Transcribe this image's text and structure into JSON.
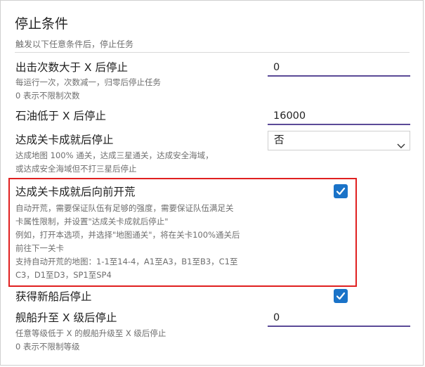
{
  "header": {
    "title": "停止条件",
    "subtitle": "触发以下任意条件后，停止任务"
  },
  "items": [
    {
      "label": "出击次数大于 X 后停止",
      "desc_lines": [
        "每运行一次，次数减一，归零后停止任务",
        "0 表示不限制次数"
      ],
      "input_value": "0"
    },
    {
      "label": "石油低于 X 后停止",
      "input_value": "16000"
    },
    {
      "label": "达成关卡成就后停止",
      "desc_lines": [
        "达成地图 100% 通关，达成三星通关，达成安全海域，",
        "或达成安全海域但不打三星后停止"
      ],
      "select_value": "否"
    },
    {
      "label": "达成关卡成就后向前开荒",
      "desc_lines": [
        "自动开荒，需要保证队伍有足够的强度，需要保证队伍满足关",
        "卡属性限制，并设置\"达成关卡成就后停止\"",
        "例如，打开本选项，并选择\"地图通关\"，将在关卡100%通关后",
        "前往下一关卡",
        "支持自动开荒的地图：1-1至14-4，A1至A3，B1至B3，C1至",
        "C3，D1至D3，SP1至SP4"
      ],
      "checked": true
    },
    {
      "label": "获得新船后停止",
      "checked": true
    },
    {
      "label": "舰船升至 X 级后停止",
      "desc_lines": [
        "任意等级低于 X 的舰船升级至 X 级后停止",
        "0 表示不限制等级"
      ],
      "input_value": "0"
    }
  ],
  "colors": {
    "accent_underline": "#5b4a97",
    "checkbox": "#1a73c8",
    "highlight_border": "#e02020"
  }
}
